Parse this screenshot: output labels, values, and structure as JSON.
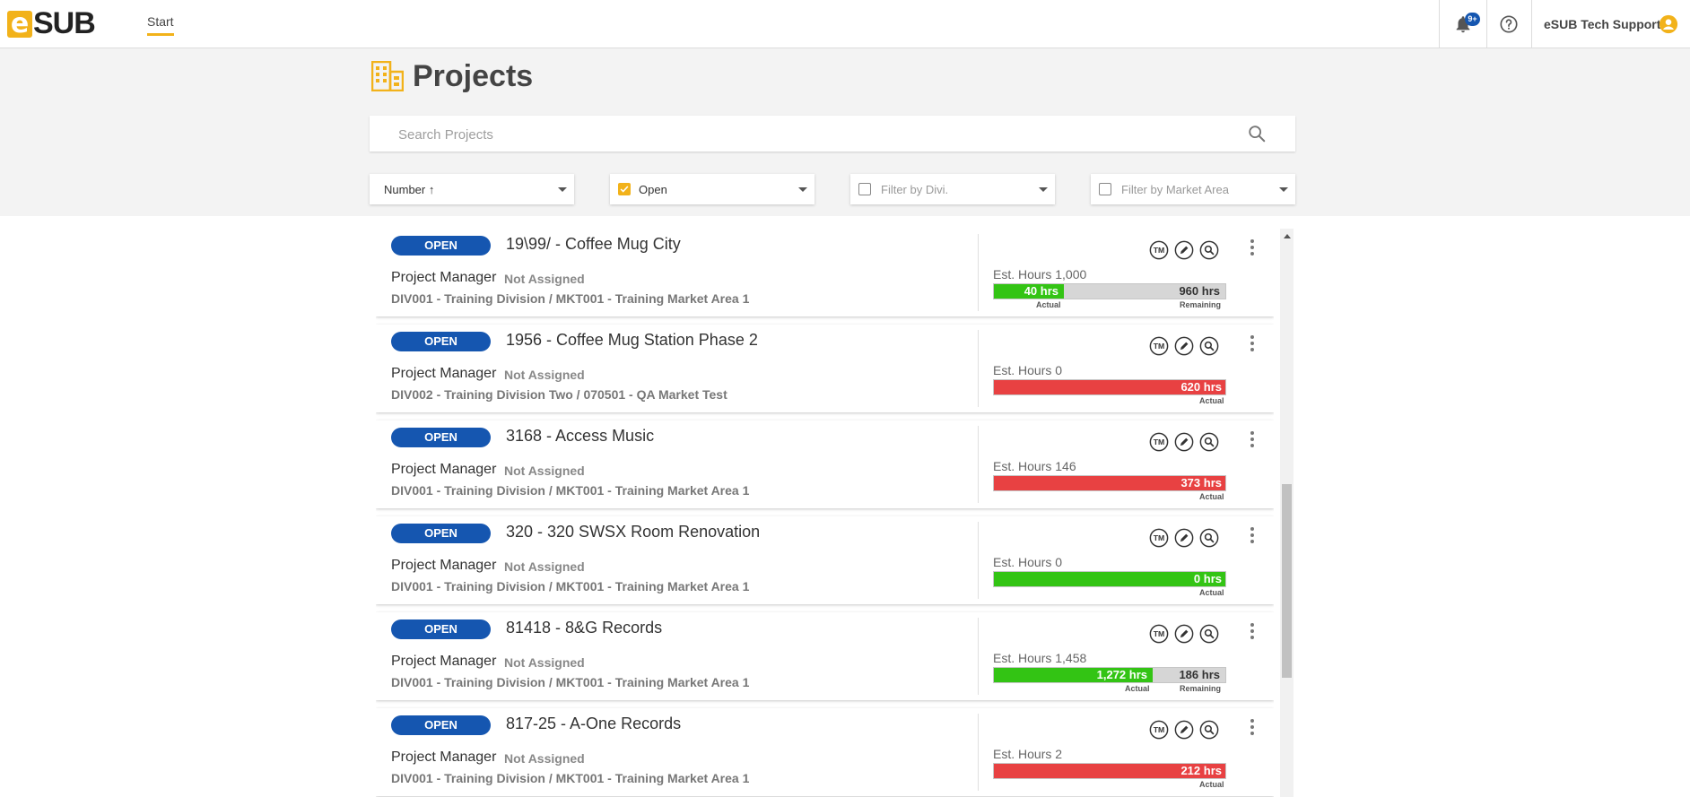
{
  "app": {
    "logo_e": "e",
    "logo_sub": "SUB",
    "nav_start": "Start",
    "notification_badge": "9+",
    "user_name": "eSUB Tech Support"
  },
  "page": {
    "title": "Projects",
    "search_placeholder": "Search Projects"
  },
  "filters": {
    "sort": "Number ↑",
    "status": "Open",
    "status_checked": true,
    "division_placeholder": "Filter by Divi.",
    "market_placeholder": "Filter by Market Area"
  },
  "colors": {
    "accent": "#f2b21a",
    "status_blue": "#1556b0",
    "bar_green": "#33c414",
    "bar_red": "#e84142"
  },
  "labels": {
    "project_manager": "Project Manager",
    "actual": "Actual",
    "remaining": "Remaining"
  },
  "projects": [
    {
      "status": "OPEN",
      "title": "19\\99/ - Coffee Mug City",
      "manager": "Not Assigned",
      "division": "DIV001 - Training Division / MKT001 - Training Market Area 1",
      "est_hours": "Est. Hours 1,000",
      "actual": "40 hrs",
      "remaining": "960 hrs",
      "fill_fraction": 0.3,
      "bar_color": "green"
    },
    {
      "status": "OPEN",
      "title": "1956 - Coffee Mug Station Phase 2",
      "manager": "Not Assigned",
      "division": "DIV002 - Training Division Two / 070501 - QA Market Test",
      "est_hours": "Est. Hours 0",
      "actual": "620 hrs",
      "remaining": "",
      "fill_fraction": 1,
      "bar_color": "red"
    },
    {
      "status": "OPEN",
      "title": "3168 - Access Music",
      "manager": "Not Assigned",
      "division": "DIV001 - Training Division / MKT001 - Training Market Area 1",
      "est_hours": "Est. Hours 146",
      "actual": "373 hrs",
      "remaining": "",
      "fill_fraction": 1,
      "bar_color": "red"
    },
    {
      "status": "OPEN",
      "title": "320 - 320 SWSX Room Renovation",
      "manager": "Not Assigned",
      "division": "DIV001 - Training Division / MKT001 - Training Market Area 1",
      "est_hours": "Est. Hours 0",
      "actual": "0 hrs",
      "remaining": "",
      "fill_fraction": 1,
      "bar_color": "green"
    },
    {
      "status": "OPEN",
      "title": "81418 - 8&G Records",
      "manager": "Not Assigned",
      "division": "DIV001 - Training Division / MKT001 - Training Market Area 1",
      "est_hours": "Est. Hours 1,458",
      "actual": "1,272 hrs",
      "remaining": "186 hrs",
      "fill_fraction": 0.682,
      "bar_color": "green"
    },
    {
      "status": "OPEN",
      "title": "817-25 - A-One Records",
      "manager": "Not Assigned",
      "division": "DIV001 - Training Division / MKT001 - Training Market Area 1",
      "est_hours": "Est. Hours 2",
      "actual": "212 hrs",
      "remaining": "",
      "fill_fraction": 1,
      "bar_color": "red"
    }
  ]
}
